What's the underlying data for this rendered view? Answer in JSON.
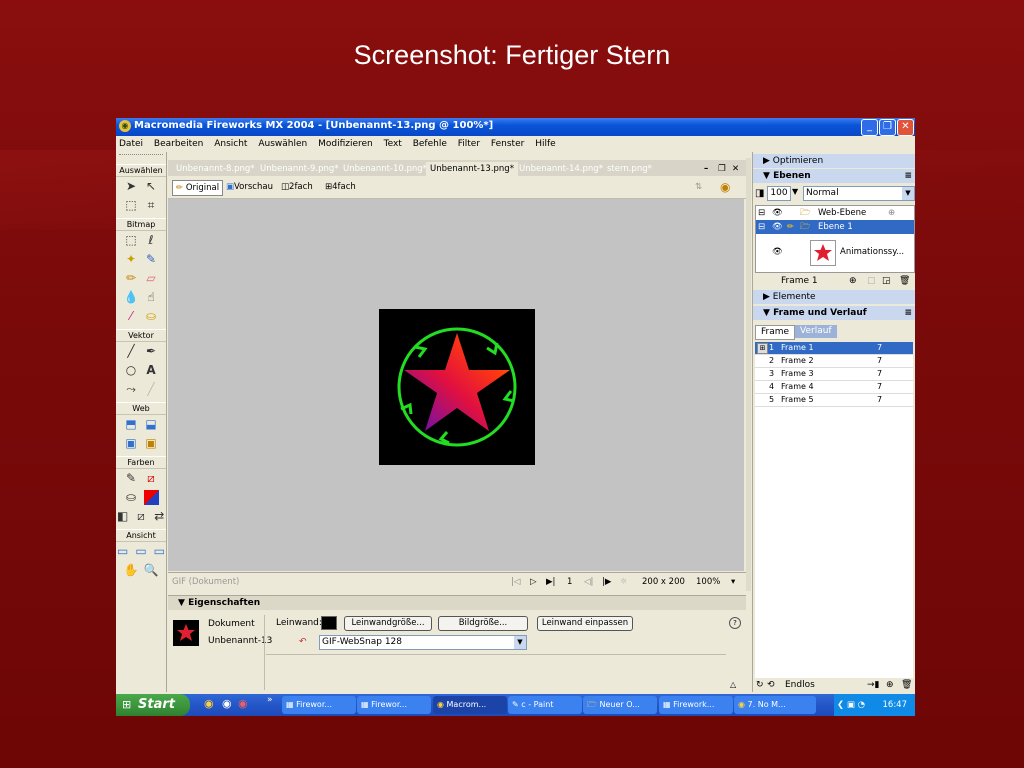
{
  "slide": {
    "title": "Screenshot: Fertiger Stern"
  },
  "window": {
    "title": "Macromedia Fireworks MX 2004 - [Unbenannt-13.png @ 100%*]",
    "min": "_",
    "restore": "❐",
    "close": "✕"
  },
  "menu": [
    "Datei",
    "Bearbeiten",
    "Ansicht",
    "Auswählen",
    "Modifizieren",
    "Text",
    "Befehle",
    "Filter",
    "Fenster",
    "Hilfe"
  ],
  "tools": {
    "sections": {
      "select": "Auswählen",
      "bitmap": "Bitmap",
      "vector": "Vektor",
      "web": "Web",
      "colors": "Farben",
      "view": "Ansicht"
    }
  },
  "doc": {
    "tabs": [
      "Unbenannt-8.png*",
      "Unbenannt-9.png*",
      "Unbenannt-10.png*",
      "Unbenannt-13.png*",
      "Unbenannt-14.png*",
      "stern.png*"
    ],
    "active_tab": 3,
    "views": {
      "original": "Original",
      "preview": "Vorschau",
      "two": "2fach",
      "four": "4fach"
    },
    "status": {
      "type": "GIF (Dokument)",
      "frame": "1",
      "size": "200 x 200",
      "zoom": "100%"
    }
  },
  "properties": {
    "header": "Eigenschaften",
    "doc_label": "Dokument",
    "doc_name": "Unbenannt-13",
    "canvas_label": "Leinwand:",
    "btn_canvas_size": "Leinwandgröße...",
    "btn_image_size": "Bildgröße...",
    "btn_fit_canvas": "Leinwand einpassen",
    "palette": "GIF-WebSnap 128",
    "help": "?"
  },
  "panels": {
    "optimize": "Optimieren",
    "layers": "Ebenen",
    "opacity": "100",
    "blend": "Normal",
    "layer_rows": [
      "Web-Ebene",
      "Ebene 1",
      "Animationssy..."
    ],
    "frame_label": "Frame 1",
    "elements": "Elemente",
    "frames_history": "Frame und Verlauf",
    "tab_frame": "Frame",
    "tab_history": "Verlauf",
    "frames": [
      {
        "num": "1",
        "name": "Frame 1",
        "delay": "7"
      },
      {
        "num": "2",
        "name": "Frame 2",
        "delay": "7"
      },
      {
        "num": "3",
        "name": "Frame 3",
        "delay": "7"
      },
      {
        "num": "4",
        "name": "Frame 4",
        "delay": "7"
      },
      {
        "num": "5",
        "name": "Frame 5",
        "delay": "7"
      }
    ],
    "loop": "Endlos"
  },
  "taskbar": {
    "start": "Start",
    "items": [
      "Firewor...",
      "Firewor...",
      "Macrom...",
      "c - Paint",
      "Neuer O...",
      "Firework...",
      "7. No M..."
    ],
    "active": 2,
    "clock": "16:47"
  },
  "colors": {
    "accent": "#0a55d8",
    "selection": "#316ac5",
    "arrow_green": "#22dd22"
  }
}
